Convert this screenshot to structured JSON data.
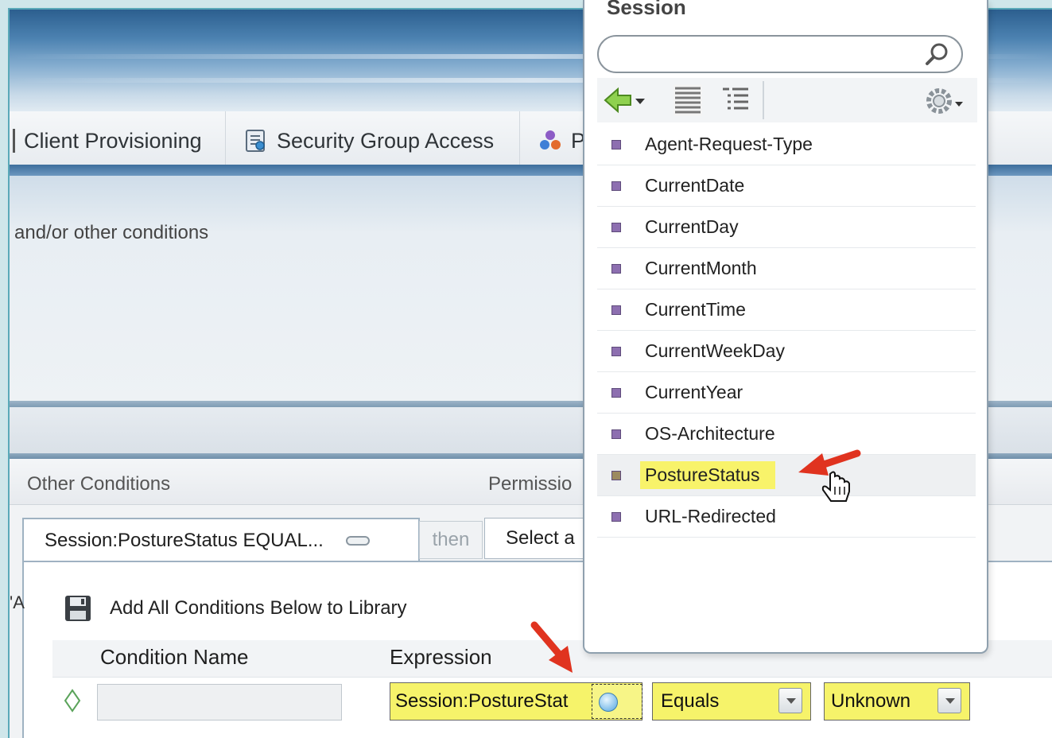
{
  "tabs": [
    {
      "label": "Client Provisioning",
      "icon": "client-provisioning-icon"
    },
    {
      "label": "Security Group Access",
      "icon": "security-group-access-icon"
    },
    {
      "label": "P",
      "icon": "people-icon"
    }
  ],
  "description": "and/or other conditions",
  "columns": {
    "other_conditions": "Other Conditions",
    "permissions": "Permissio"
  },
  "condition_tab": {
    "label": "Session:PostureStatus EQUAL...",
    "then": "then",
    "select": "Select a"
  },
  "library": {
    "add_label": "Add All Conditions Below to Library"
  },
  "grid": {
    "headers": {
      "name": "Condition Name",
      "expression": "Expression"
    },
    "row": {
      "name_value": "",
      "attribute": "Session:PostureStat",
      "operator": "Equals",
      "value": "Unknown"
    }
  },
  "edge_mark": "'A",
  "popup": {
    "title": "Session",
    "search_placeholder": "",
    "items": [
      "Agent-Request-Type",
      "CurrentDate",
      "CurrentDay",
      "CurrentMonth",
      "CurrentTime",
      "CurrentWeekDay",
      "CurrentYear",
      "OS-Architecture",
      "PostureStatus",
      "URL-Redirected"
    ],
    "highlighted_item": "PostureStatus"
  },
  "colors": {
    "highlight_yellow": "#f6f36a",
    "annotation_red": "#e0331f",
    "bullet_purple": "#8d6fb0",
    "header_blue": "#2c5f8f"
  }
}
